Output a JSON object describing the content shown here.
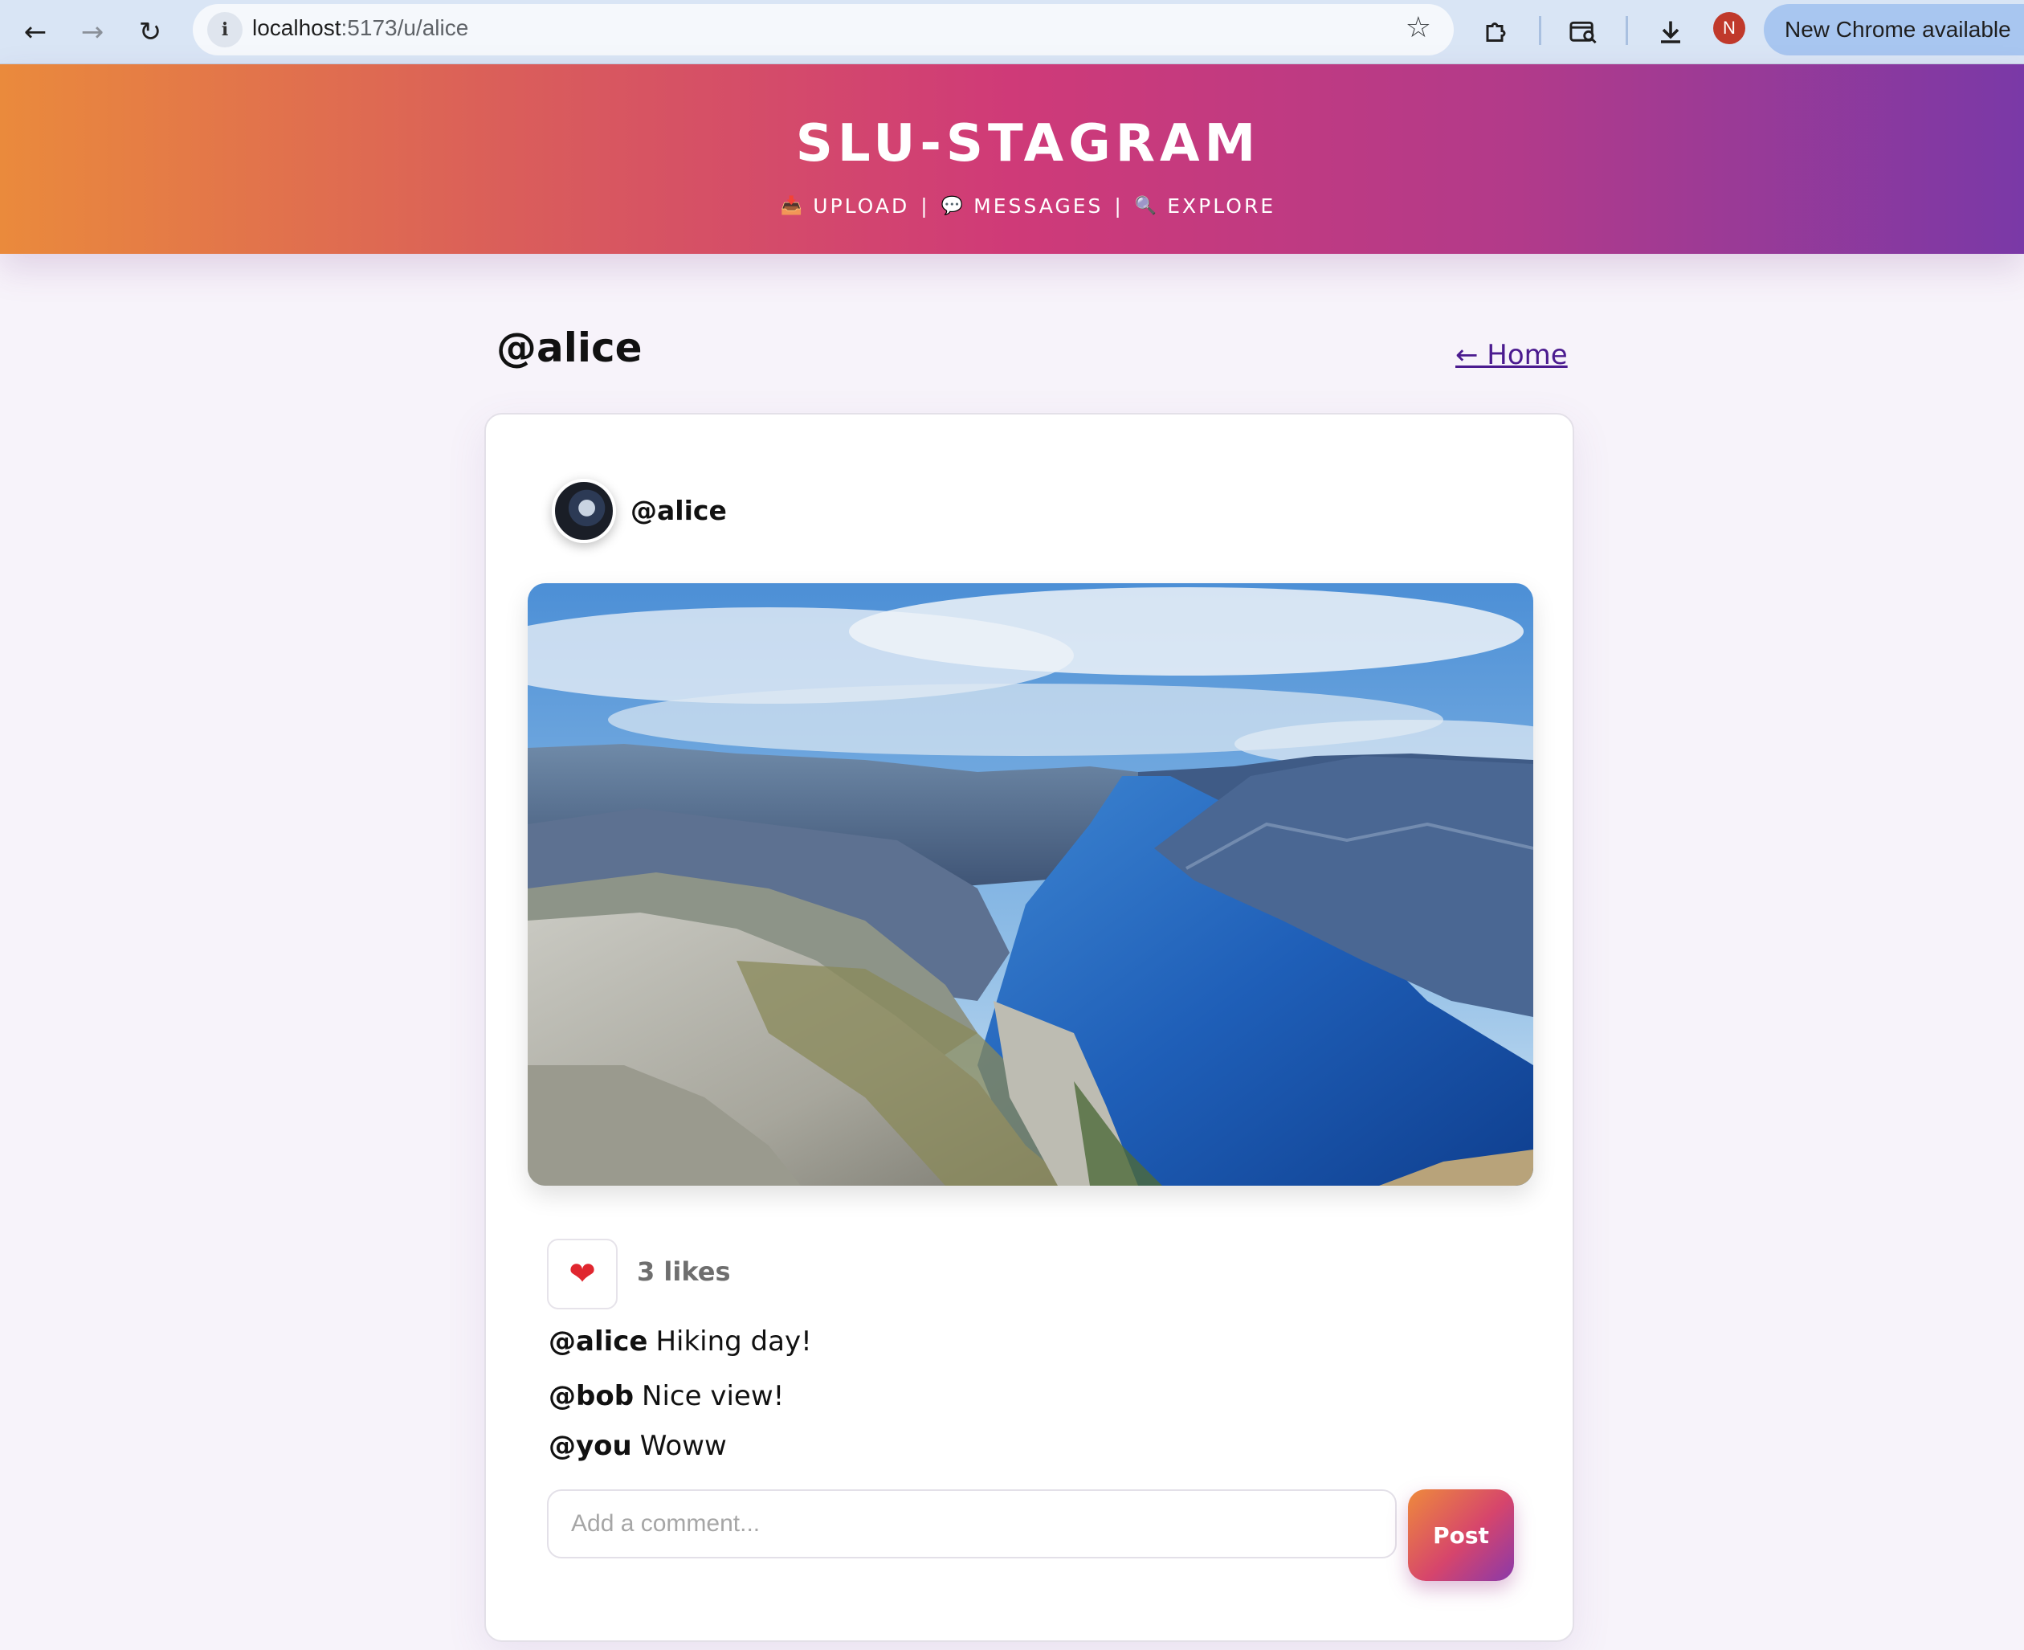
{
  "browser": {
    "url_host": "localhost",
    "url_path": ":5173/u/alice",
    "profile_initial": "N",
    "update_label": "New Chrome available"
  },
  "app": {
    "brand": "SLU-STAGRAM",
    "nav": {
      "upload": "UPLOAD",
      "messages": "MESSAGES",
      "explore": "EXPLORE",
      "separator": "|"
    }
  },
  "profile": {
    "title": "@alice",
    "home_link": "← Home"
  },
  "post": {
    "author": "@alice",
    "likes_text": "3 likes",
    "caption": {
      "user": "@alice",
      "text": "Hiking day!"
    },
    "comments": [
      {
        "user": "@bob",
        "text": "Nice view!"
      },
      {
        "user": "@you",
        "text": "Woww"
      }
    ],
    "comment_placeholder": "Add a comment...",
    "post_button": "Post"
  },
  "icons": {
    "back": "back-arrow-icon",
    "forward": "forward-arrow-icon",
    "reload": "reload-icon",
    "site_info": "info-icon",
    "bookmark": "star-icon",
    "extensions": "puzzle-icon",
    "search_tab": "tab-search-icon",
    "downloads": "download-icon",
    "upload": "inbox-tray-icon",
    "messages": "speech-bubble-icon",
    "explore": "magnifier-icon",
    "like": "heart-icon"
  },
  "colors": {
    "header_gradient_start": "#ea8a3c",
    "header_gradient_mid": "#cf3a78",
    "header_gradient_end": "#7a39a7",
    "link": "#4b1b8f",
    "like_heart": "#e0262f"
  }
}
